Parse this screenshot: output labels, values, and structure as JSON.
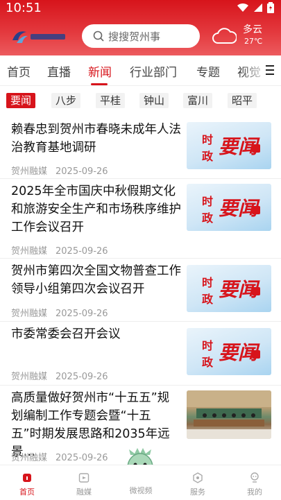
{
  "status": {
    "time": "10:51"
  },
  "header": {
    "search_placeholder": "搜搜贺州事",
    "weather": {
      "condition": "多云",
      "temperature": "27℃",
      "icon": "cloud-icon"
    }
  },
  "tabs": [
    "首页",
    "直播",
    "新闻",
    "行业部门",
    "专题",
    "视觉"
  ],
  "active_tab": "新闻",
  "subtabs": [
    "要闻",
    "八步",
    "平桂",
    "钟山",
    "富川",
    "昭平"
  ],
  "active_subtab": "要闻",
  "news": [
    {
      "title": "赖春忠到贺州市春晓未成年人法治教育基地调研",
      "source": "贺州融媒",
      "date": "2025-09-26",
      "thumb": {
        "type": "banner",
        "line1": "时",
        "line2": "政",
        "big": "要闻"
      }
    },
    {
      "title": "2025年全市国庆中秋假期文化和旅游安全生产和市场秩序维护工作会议召开",
      "source": "贺州融媒",
      "date": "2025-09-26",
      "thumb": {
        "type": "banner",
        "line1": "时",
        "line2": "政",
        "big": "要闻"
      }
    },
    {
      "title": "贺州市第四次全国文物普查工作领导小组第四次会议召开",
      "source": "贺州融媒",
      "date": "2025-09-26",
      "thumb": {
        "type": "banner",
        "line1": "时",
        "line2": "政",
        "big": "要闻"
      }
    },
    {
      "title": "市委常委会召开会议",
      "source": "贺州融媒",
      "date": "2025-09-26",
      "thumb": {
        "type": "banner",
        "line1": "时",
        "line2": "政",
        "big": "要闻"
      }
    },
    {
      "title": "高质量做好贺州市“十五五”规划编制工作专题会暨“十五五”时期发展思路和2035年远景…",
      "source": "贺州融媒",
      "date": "2025-09-26",
      "thumb": {
        "type": "photo"
      }
    }
  ],
  "bottom_nav": [
    {
      "label": "首页",
      "icon": "home-icon",
      "active": true
    },
    {
      "label": "融媒",
      "icon": "media-icon",
      "active": false
    },
    {
      "label": "微视频",
      "icon": "mascot-icon",
      "active": false
    },
    {
      "label": "服务",
      "icon": "service-icon",
      "active": false
    },
    {
      "label": "我的",
      "icon": "profile-icon",
      "active": false
    }
  ],
  "colors": {
    "brand": "#d7141b"
  }
}
